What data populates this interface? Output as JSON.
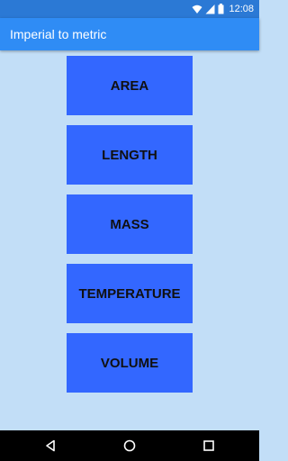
{
  "status_bar": {
    "time": "12:08",
    "icons": [
      "wifi-icon",
      "cell-signal-icon",
      "battery-icon"
    ]
  },
  "app_bar": {
    "title": "Imperial to metric"
  },
  "menu": {
    "buttons": [
      {
        "label": "AREA"
      },
      {
        "label": "LENGTH"
      },
      {
        "label": "MASS"
      },
      {
        "label": "TEMPERATURE"
      },
      {
        "label": "VOLUME"
      }
    ]
  },
  "nav_bar": {
    "icons": [
      "back-icon",
      "home-icon",
      "recents-icon"
    ]
  },
  "colors": {
    "status_bar": "#2b79d5",
    "app_bar": "#2f8cf5",
    "background": "#c2def7",
    "button": "#3367ff",
    "nav_bar": "#000000"
  }
}
